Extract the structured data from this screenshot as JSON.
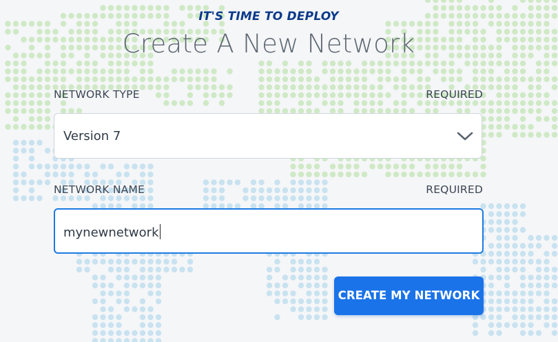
{
  "header": {
    "eyebrow": "IT'S TIME TO DEPLOY",
    "title": "Create A New Network"
  },
  "form": {
    "network_type": {
      "label": "NETWORK TYPE",
      "required_label": "REQUIRED",
      "selected_value": "Version 7",
      "icon": "chevron-down-icon"
    },
    "network_name": {
      "label": "NETWORK NAME",
      "required_label": "REQUIRED",
      "value": "mynewnetwork"
    },
    "submit_label": "CREATE MY NETWORK"
  },
  "colors": {
    "eyebrow": "#0b3a8a",
    "accent": "#1a73e8",
    "input_focus_border": "#1c7ae3",
    "map_dots_green": "#cfe9c6",
    "map_dots_blue": "#c9e2f0",
    "background": "#f5f6f8"
  }
}
